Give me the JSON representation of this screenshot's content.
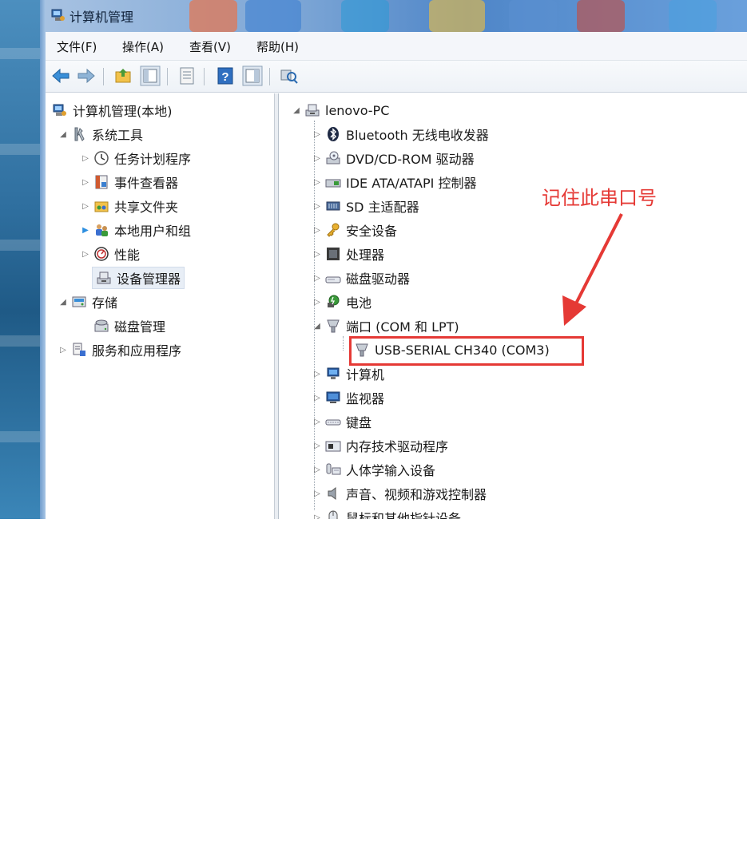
{
  "window": {
    "title": "计算机管理"
  },
  "menu": [
    {
      "label": "文件(F)"
    },
    {
      "label": "操作(A)"
    },
    {
      "label": "查看(V)"
    },
    {
      "label": "帮助(H)"
    }
  ],
  "left_tree": {
    "root": "计算机管理(本地)",
    "system_tools": "系统工具",
    "task_scheduler": "任务计划程序",
    "event_viewer": "事件查看器",
    "shared_folders": "共享文件夹",
    "local_users": "本地用户和组",
    "performance": "性能",
    "device_manager": "设备管理器",
    "storage": "存储",
    "disk_management": "磁盘管理",
    "services_apps": "服务和应用程序"
  },
  "device_tree": {
    "computer": "lenovo-PC",
    "categories": [
      "Bluetooth 无线电收发器",
      "DVD/CD-ROM 驱动器",
      "IDE ATA/ATAPI 控制器",
      "SD 主适配器",
      "安全设备",
      "处理器",
      "磁盘驱动器",
      "电池",
      "端口 (COM 和 LPT)",
      "计算机",
      "监视器",
      "键盘",
      "内存技术驱动程序",
      "人体学输入设备",
      "声音、视频和游戏控制器",
      "鼠标和其他指针设备"
    ],
    "port_device": "USB-SERIAL CH340 (COM3)"
  },
  "annotation": {
    "text": "记住此串口号",
    "color": "#e53935"
  }
}
